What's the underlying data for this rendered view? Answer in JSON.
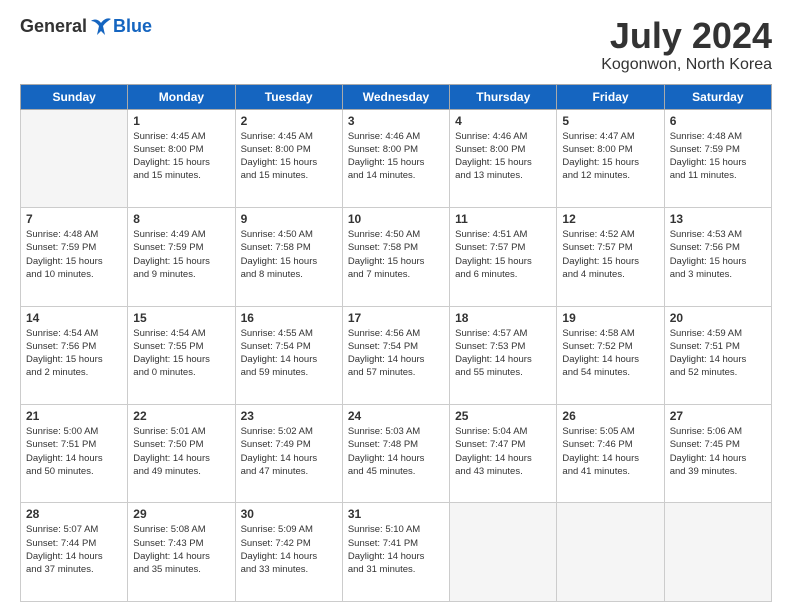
{
  "logo": {
    "general": "General",
    "blue": "Blue"
  },
  "title": "July 2024",
  "location": "Kogonwon, North Korea",
  "headers": [
    "Sunday",
    "Monday",
    "Tuesday",
    "Wednesday",
    "Thursday",
    "Friday",
    "Saturday"
  ],
  "weeks": [
    [
      {
        "day": "",
        "info": ""
      },
      {
        "day": "1",
        "info": "Sunrise: 4:45 AM\nSunset: 8:00 PM\nDaylight: 15 hours\nand 15 minutes."
      },
      {
        "day": "2",
        "info": "Sunrise: 4:45 AM\nSunset: 8:00 PM\nDaylight: 15 hours\nand 15 minutes."
      },
      {
        "day": "3",
        "info": "Sunrise: 4:46 AM\nSunset: 8:00 PM\nDaylight: 15 hours\nand 14 minutes."
      },
      {
        "day": "4",
        "info": "Sunrise: 4:46 AM\nSunset: 8:00 PM\nDaylight: 15 hours\nand 13 minutes."
      },
      {
        "day": "5",
        "info": "Sunrise: 4:47 AM\nSunset: 8:00 PM\nDaylight: 15 hours\nand 12 minutes."
      },
      {
        "day": "6",
        "info": "Sunrise: 4:48 AM\nSunset: 7:59 PM\nDaylight: 15 hours\nand 11 minutes."
      }
    ],
    [
      {
        "day": "7",
        "info": "Sunrise: 4:48 AM\nSunset: 7:59 PM\nDaylight: 15 hours\nand 10 minutes."
      },
      {
        "day": "8",
        "info": "Sunrise: 4:49 AM\nSunset: 7:59 PM\nDaylight: 15 hours\nand 9 minutes."
      },
      {
        "day": "9",
        "info": "Sunrise: 4:50 AM\nSunset: 7:58 PM\nDaylight: 15 hours\nand 8 minutes."
      },
      {
        "day": "10",
        "info": "Sunrise: 4:50 AM\nSunset: 7:58 PM\nDaylight: 15 hours\nand 7 minutes."
      },
      {
        "day": "11",
        "info": "Sunrise: 4:51 AM\nSunset: 7:57 PM\nDaylight: 15 hours\nand 6 minutes."
      },
      {
        "day": "12",
        "info": "Sunrise: 4:52 AM\nSunset: 7:57 PM\nDaylight: 15 hours\nand 4 minutes."
      },
      {
        "day": "13",
        "info": "Sunrise: 4:53 AM\nSunset: 7:56 PM\nDaylight: 15 hours\nand 3 minutes."
      }
    ],
    [
      {
        "day": "14",
        "info": "Sunrise: 4:54 AM\nSunset: 7:56 PM\nDaylight: 15 hours\nand 2 minutes."
      },
      {
        "day": "15",
        "info": "Sunrise: 4:54 AM\nSunset: 7:55 PM\nDaylight: 15 hours\nand 0 minutes."
      },
      {
        "day": "16",
        "info": "Sunrise: 4:55 AM\nSunset: 7:54 PM\nDaylight: 14 hours\nand 59 minutes."
      },
      {
        "day": "17",
        "info": "Sunrise: 4:56 AM\nSunset: 7:54 PM\nDaylight: 14 hours\nand 57 minutes."
      },
      {
        "day": "18",
        "info": "Sunrise: 4:57 AM\nSunset: 7:53 PM\nDaylight: 14 hours\nand 55 minutes."
      },
      {
        "day": "19",
        "info": "Sunrise: 4:58 AM\nSunset: 7:52 PM\nDaylight: 14 hours\nand 54 minutes."
      },
      {
        "day": "20",
        "info": "Sunrise: 4:59 AM\nSunset: 7:51 PM\nDaylight: 14 hours\nand 52 minutes."
      }
    ],
    [
      {
        "day": "21",
        "info": "Sunrise: 5:00 AM\nSunset: 7:51 PM\nDaylight: 14 hours\nand 50 minutes."
      },
      {
        "day": "22",
        "info": "Sunrise: 5:01 AM\nSunset: 7:50 PM\nDaylight: 14 hours\nand 49 minutes."
      },
      {
        "day": "23",
        "info": "Sunrise: 5:02 AM\nSunset: 7:49 PM\nDaylight: 14 hours\nand 47 minutes."
      },
      {
        "day": "24",
        "info": "Sunrise: 5:03 AM\nSunset: 7:48 PM\nDaylight: 14 hours\nand 45 minutes."
      },
      {
        "day": "25",
        "info": "Sunrise: 5:04 AM\nSunset: 7:47 PM\nDaylight: 14 hours\nand 43 minutes."
      },
      {
        "day": "26",
        "info": "Sunrise: 5:05 AM\nSunset: 7:46 PM\nDaylight: 14 hours\nand 41 minutes."
      },
      {
        "day": "27",
        "info": "Sunrise: 5:06 AM\nSunset: 7:45 PM\nDaylight: 14 hours\nand 39 minutes."
      }
    ],
    [
      {
        "day": "28",
        "info": "Sunrise: 5:07 AM\nSunset: 7:44 PM\nDaylight: 14 hours\nand 37 minutes."
      },
      {
        "day": "29",
        "info": "Sunrise: 5:08 AM\nSunset: 7:43 PM\nDaylight: 14 hours\nand 35 minutes."
      },
      {
        "day": "30",
        "info": "Sunrise: 5:09 AM\nSunset: 7:42 PM\nDaylight: 14 hours\nand 33 minutes."
      },
      {
        "day": "31",
        "info": "Sunrise: 5:10 AM\nSunset: 7:41 PM\nDaylight: 14 hours\nand 31 minutes."
      },
      {
        "day": "",
        "info": ""
      },
      {
        "day": "",
        "info": ""
      },
      {
        "day": "",
        "info": ""
      }
    ]
  ]
}
